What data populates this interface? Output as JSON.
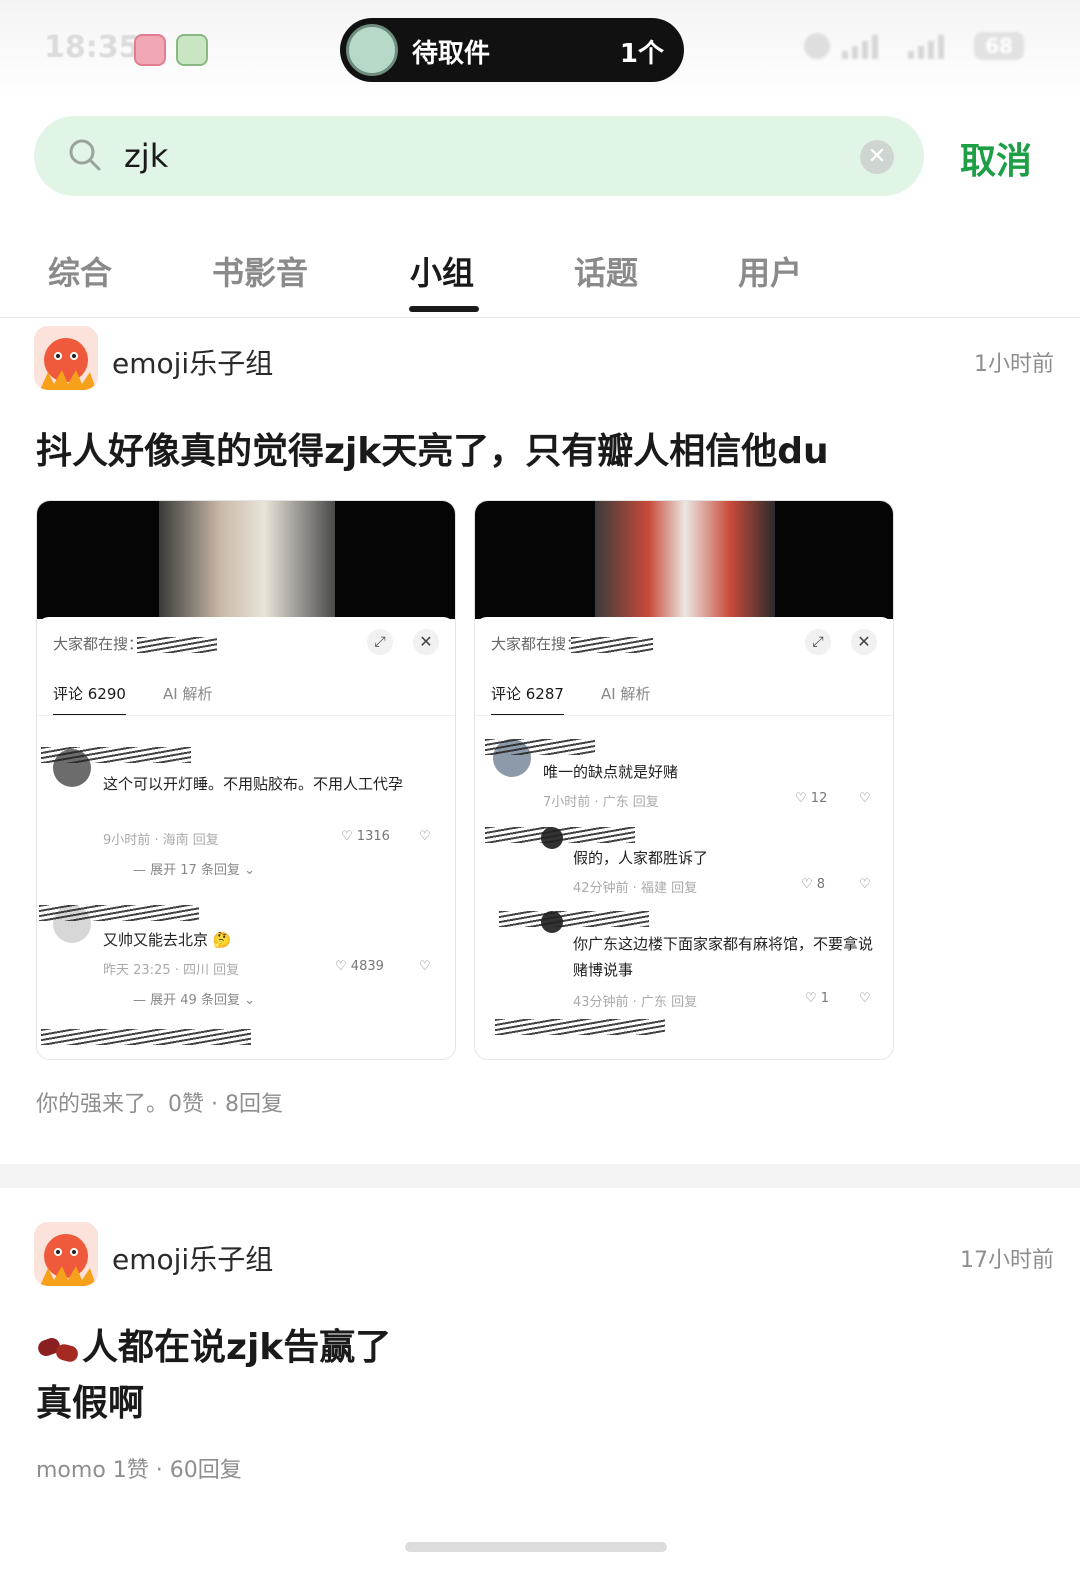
{
  "status_bar": {
    "time": "18:35",
    "live_activity": {
      "title": "待取件",
      "count": "1个"
    },
    "network_1": "5A",
    "network_2": "5A",
    "battery": "68"
  },
  "search": {
    "query": "zjk",
    "placeholder": "",
    "cancel_label": "取消"
  },
  "tabs": {
    "items": [
      "综合",
      "书影音",
      "小组",
      "话题",
      "用户"
    ],
    "active": "小组"
  },
  "posts": [
    {
      "group": "emoji乐子组",
      "time": "1小时前",
      "title": "抖人好像真的觉得zjk天亮了，只有瓣人相信他du",
      "meta": "你的强来了。0赞 · 8回复",
      "screenshots": [
        {
          "header": "大家都在搜：",
          "comment_tab": "评论 6290",
          "ai_tab": "AI 解析",
          "comments": [
            {
              "text": "这个可以开灯睡。不用贴胶布。不用人工代孕",
              "meta": "9小时前 · 海南   回复",
              "likes": "1316",
              "expand": "展开 17 条回复"
            },
            {
              "text": "又帅又能去北京",
              "meta": "昨天 23:25 · 四川   回复",
              "likes": "4839",
              "expand": "展开 49 条回复"
            }
          ]
        },
        {
          "header": "大家都在搜：",
          "comment_tab": "评论 6287",
          "ai_tab": "AI 解析",
          "comments": [
            {
              "text": "唯一的缺点就是好赌",
              "meta": "7小时前 · 广东   回复",
              "likes": "12"
            },
            {
              "text": "假的，人家都胜诉了",
              "meta": "42分钟前 · 福建   回复",
              "likes": "8"
            },
            {
              "text": "你广东这边楼下面家家都有麻将馆，不要拿说赌博说事",
              "meta": "43分钟前 · 广东   回复",
              "likes": "1"
            }
          ]
        }
      ]
    },
    {
      "group": "emoji乐子组",
      "time": "17小时前",
      "title_line1": "人都在说zjk告赢了",
      "title_line2": "真假啊",
      "meta": "momo 1赞 · 60回复"
    }
  ]
}
